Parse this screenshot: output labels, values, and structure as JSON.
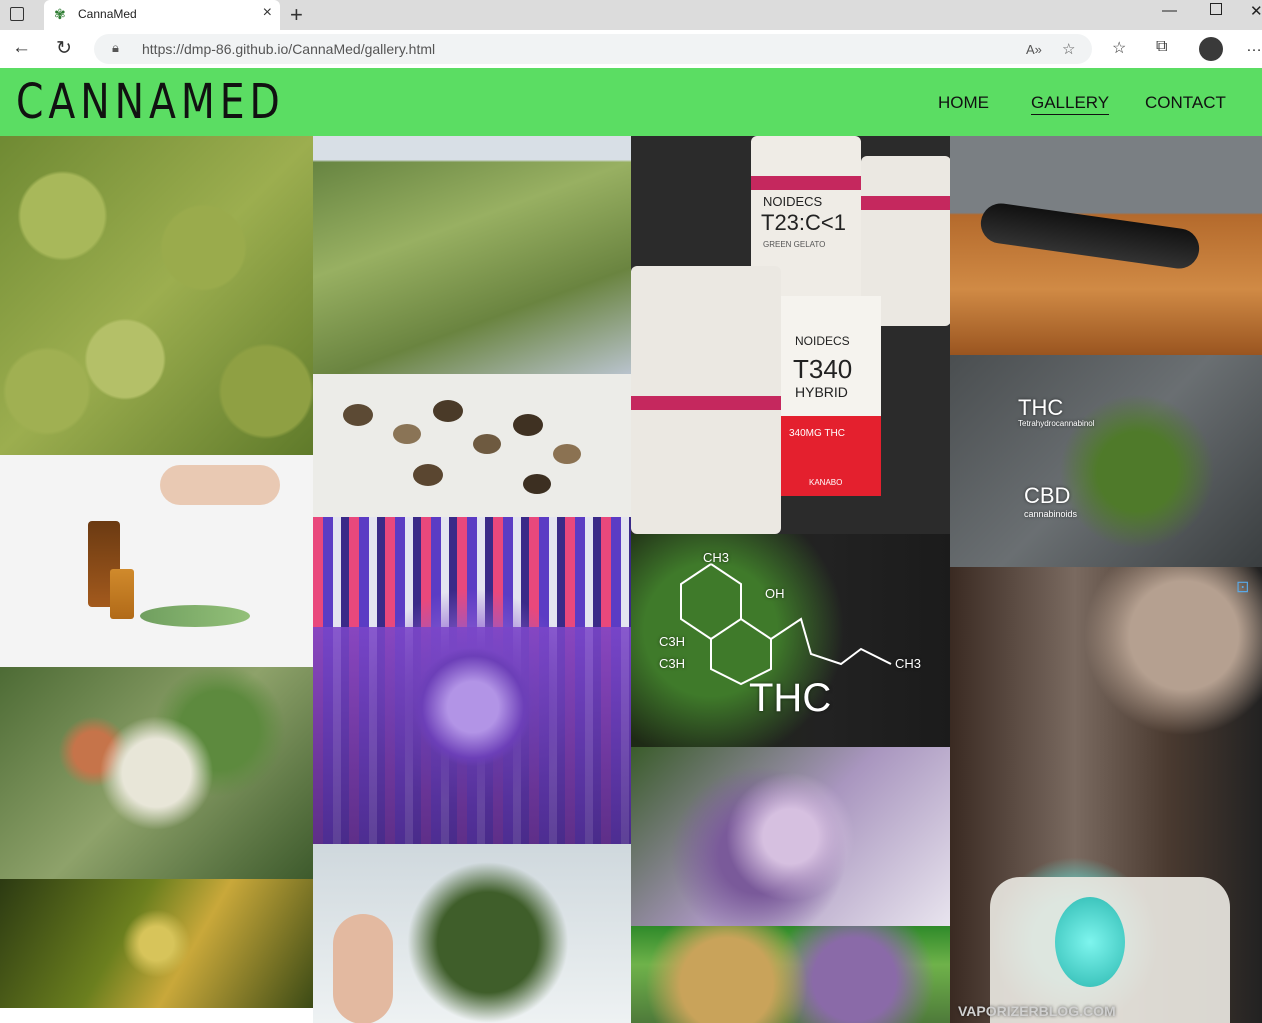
{
  "browser": {
    "tab_title": "CannaMed",
    "url": "https://dmp-86.github.io/CannaMed/gallery.html",
    "icons": [
      "tab-actions-icon",
      "cannabis-leaf-icon",
      "close-icon",
      "new-tab-icon",
      "back-icon",
      "refresh-icon",
      "lock-icon",
      "read-aloud-icon",
      "favorite-add-icon",
      "favorites-icon",
      "collections-icon",
      "profile-avatar",
      "more-icon"
    ]
  },
  "site": {
    "logo": "CANNAMED",
    "nav": [
      {
        "label": "HOME",
        "active": false
      },
      {
        "label": "GALLERY",
        "active": true
      },
      {
        "label": "CONTACT",
        "active": false
      }
    ],
    "brand_color": "#5bdd63"
  },
  "gallery": {
    "jar_label_1": "NOIDECS",
    "jar_code": "T23:C<1",
    "jar_flavor": "GREEN GELATO",
    "box_brand": "NOIDECS",
    "box_code": "T340",
    "box_type": "HYBRID",
    "box_dose": "340MG THC",
    "box_maker": "KANABO",
    "chem_thc_title": "THC",
    "chem_thc_sub": "Tetrahydrocannabinol",
    "chem_cbd_title": "CBD",
    "chem_cbd_sub": "cannabinoids",
    "thc_big": "THC",
    "thc_ch3_top": "CH3",
    "thc_oh": "OH",
    "thc_c3h_1": "C3H",
    "thc_c3h_2": "C3H",
    "thc_ch3_right": "CH3",
    "watermark": "VAPORIZERBLOG.COM"
  }
}
